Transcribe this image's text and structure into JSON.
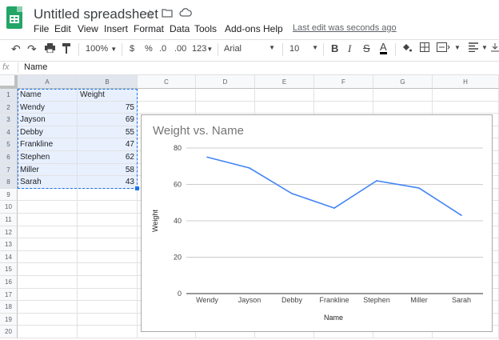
{
  "app": {
    "title": "Untitled spreadsheet",
    "last_edit": "Last edit was seconds ago"
  },
  "menu": [
    "File",
    "Edit",
    "View",
    "Insert",
    "Format",
    "Data",
    "Tools",
    "Add-ons",
    "Help"
  ],
  "toolbar": {
    "zoom": "100%",
    "currency": "$",
    "percent": "%",
    "dec_less": ".0",
    "dec_more": ".00",
    "number_format": "123",
    "font": "Arial",
    "font_size": "10"
  },
  "formula_bar": {
    "fx": "fx",
    "value": "Name"
  },
  "columns": [
    "A",
    "B",
    "C",
    "D",
    "E",
    "F",
    "G",
    "H"
  ],
  "rows": [
    "1",
    "2",
    "3",
    "4",
    "5",
    "6",
    "7",
    "8",
    "9",
    "10",
    "11",
    "12",
    "13",
    "14",
    "15",
    "16",
    "17",
    "18",
    "19",
    "20"
  ],
  "cells": [
    [
      "Name",
      "Weight"
    ],
    [
      "Wendy",
      "75"
    ],
    [
      "Jayson",
      "69"
    ],
    [
      "Debby",
      "55"
    ],
    [
      "Frankline",
      "47"
    ],
    [
      "Stephen",
      "62"
    ],
    [
      "Miller",
      "58"
    ],
    [
      "Sarah",
      "43"
    ]
  ],
  "chart_data": {
    "type": "line",
    "title": "Weight vs. Name",
    "xlabel": "Name",
    "ylabel": "Weight",
    "categories": [
      "Wendy",
      "Jayson",
      "Debby",
      "Frankline",
      "Stephen",
      "Miller",
      "Sarah"
    ],
    "series": [
      {
        "values": [
          75,
          69,
          55,
          47,
          62,
          58,
          43
        ],
        "color": "#4285f4"
      }
    ],
    "ylim": [
      0,
      80
    ],
    "yticks": [
      0,
      20,
      40,
      60,
      80
    ],
    "grid": true
  }
}
